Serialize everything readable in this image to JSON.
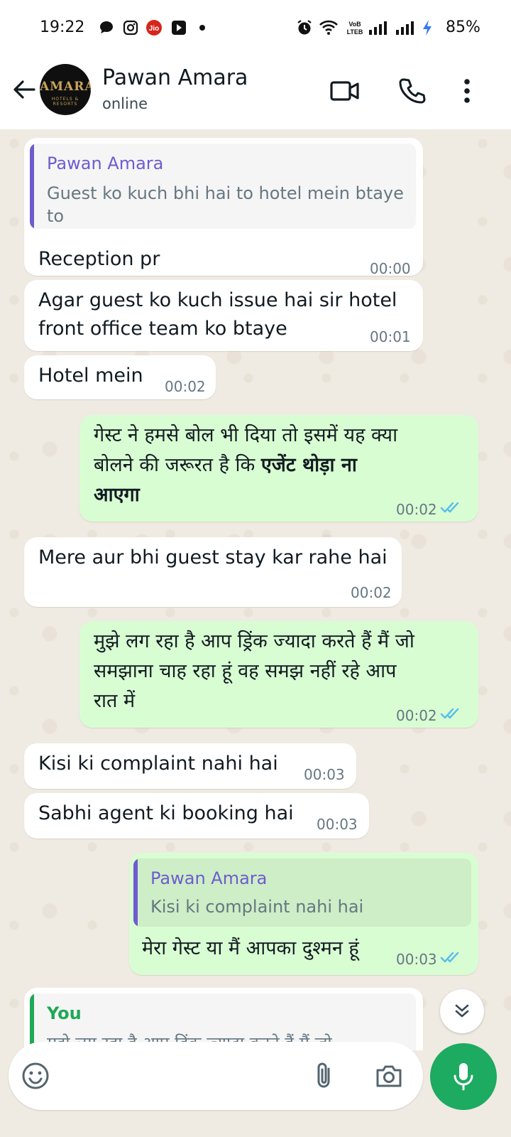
{
  "status_bar": {
    "time": "19:22",
    "battery": "85%",
    "icons": [
      "chat-bubble-icon",
      "instagram-icon",
      "jio-icon",
      "youtube-icon",
      "dot-icon",
      "alarm-icon",
      "wifi-icon",
      "volte-icon",
      "signal-icon",
      "signal-icon",
      "charging-icon"
    ]
  },
  "header": {
    "contact_name": "Pawan Amara",
    "status": "online",
    "avatar_text": "AMARA",
    "avatar_sub": "HOTELS & RESORTS"
  },
  "messages": [
    {
      "dir": "in",
      "quote_name": "Pawan Amara",
      "quote_line1": "Guest ko kuch bhi hai to hotel mein btaye",
      "quote_line2": "to",
      "line1": "Reception pr",
      "time": "00:00"
    },
    {
      "dir": "in",
      "line1": "Agar guest ko kuch issue hai sir hotel",
      "line2": "front office team ko btaye",
      "time": "00:01"
    },
    {
      "dir": "in",
      "line1": "Hotel mein",
      "time": "00:02"
    },
    {
      "dir": "out",
      "line1": "गेस्ट ने हमसे बोल भी दिया तो इसमें यह क्या",
      "line2a": "बोलने की जरूरत है कि ",
      "line2b": "एजेंट थोड़ा ना",
      "line3": "आएगा",
      "time": "00:02"
    },
    {
      "dir": "in",
      "line1": "Mere aur bhi guest stay kar rahe hai",
      "time": "00:02"
    },
    {
      "dir": "out",
      "line1": "मुझे लग रहा है आप ड्रिंक ज्यादा करते हैं मैं जो",
      "line2": "समझाना चाह रहा हूं वह समझ नहीं रहे आप",
      "line3": "रात में",
      "time": "00:02"
    },
    {
      "dir": "in",
      "line1": "Kisi ki complaint nahi hai",
      "time": "00:03"
    },
    {
      "dir": "in",
      "line1": "Sabhi agent ki booking hai",
      "time": "00:03"
    },
    {
      "dir": "out",
      "quote_name": "Pawan Amara",
      "quote_line1": "Kisi ki complaint nahi hai",
      "line1": "मेरा गेस्ट या मैं आपका दुश्मन हूं",
      "time": "00:03"
    },
    {
      "dir": "in",
      "quote_name": "You",
      "quote_line1": "मुझे लग रहा है आप ड्रिंक ज्यादा करते हैं मैं जो"
    }
  ],
  "colors": {
    "incoming_bubble": "#ffffff",
    "outgoing_bubble": "#d9fdd3",
    "chat_background": "#efeae2",
    "quote_name_contact": "#6e5ccf",
    "quote_name_you": "#1fa855",
    "read_ticks": "#53bdeb",
    "mic_button": "#1daa61"
  },
  "composer": {
    "icons": [
      "emoji-icon",
      "attach-icon",
      "camera-icon",
      "mic-icon"
    ]
  }
}
